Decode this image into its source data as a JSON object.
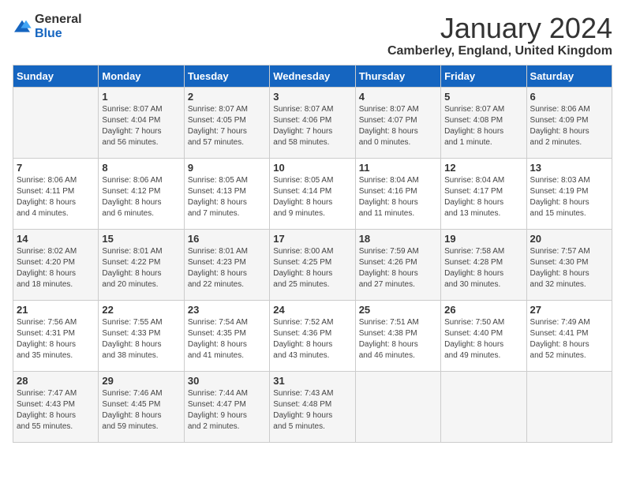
{
  "logo": {
    "general": "General",
    "blue": "Blue"
  },
  "title": "January 2024",
  "location": "Camberley, England, United Kingdom",
  "headers": [
    "Sunday",
    "Monday",
    "Tuesday",
    "Wednesday",
    "Thursday",
    "Friday",
    "Saturday"
  ],
  "weeks": [
    [
      {
        "day": "",
        "info": ""
      },
      {
        "day": "1",
        "info": "Sunrise: 8:07 AM\nSunset: 4:04 PM\nDaylight: 7 hours\nand 56 minutes."
      },
      {
        "day": "2",
        "info": "Sunrise: 8:07 AM\nSunset: 4:05 PM\nDaylight: 7 hours\nand 57 minutes."
      },
      {
        "day": "3",
        "info": "Sunrise: 8:07 AM\nSunset: 4:06 PM\nDaylight: 7 hours\nand 58 minutes."
      },
      {
        "day": "4",
        "info": "Sunrise: 8:07 AM\nSunset: 4:07 PM\nDaylight: 8 hours\nand 0 minutes."
      },
      {
        "day": "5",
        "info": "Sunrise: 8:07 AM\nSunset: 4:08 PM\nDaylight: 8 hours\nand 1 minute."
      },
      {
        "day": "6",
        "info": "Sunrise: 8:06 AM\nSunset: 4:09 PM\nDaylight: 8 hours\nand 2 minutes."
      }
    ],
    [
      {
        "day": "7",
        "info": "Sunrise: 8:06 AM\nSunset: 4:11 PM\nDaylight: 8 hours\nand 4 minutes."
      },
      {
        "day": "8",
        "info": "Sunrise: 8:06 AM\nSunset: 4:12 PM\nDaylight: 8 hours\nand 6 minutes."
      },
      {
        "day": "9",
        "info": "Sunrise: 8:05 AM\nSunset: 4:13 PM\nDaylight: 8 hours\nand 7 minutes."
      },
      {
        "day": "10",
        "info": "Sunrise: 8:05 AM\nSunset: 4:14 PM\nDaylight: 8 hours\nand 9 minutes."
      },
      {
        "day": "11",
        "info": "Sunrise: 8:04 AM\nSunset: 4:16 PM\nDaylight: 8 hours\nand 11 minutes."
      },
      {
        "day": "12",
        "info": "Sunrise: 8:04 AM\nSunset: 4:17 PM\nDaylight: 8 hours\nand 13 minutes."
      },
      {
        "day": "13",
        "info": "Sunrise: 8:03 AM\nSunset: 4:19 PM\nDaylight: 8 hours\nand 15 minutes."
      }
    ],
    [
      {
        "day": "14",
        "info": "Sunrise: 8:02 AM\nSunset: 4:20 PM\nDaylight: 8 hours\nand 18 minutes."
      },
      {
        "day": "15",
        "info": "Sunrise: 8:01 AM\nSunset: 4:22 PM\nDaylight: 8 hours\nand 20 minutes."
      },
      {
        "day": "16",
        "info": "Sunrise: 8:01 AM\nSunset: 4:23 PM\nDaylight: 8 hours\nand 22 minutes."
      },
      {
        "day": "17",
        "info": "Sunrise: 8:00 AM\nSunset: 4:25 PM\nDaylight: 8 hours\nand 25 minutes."
      },
      {
        "day": "18",
        "info": "Sunrise: 7:59 AM\nSunset: 4:26 PM\nDaylight: 8 hours\nand 27 minutes."
      },
      {
        "day": "19",
        "info": "Sunrise: 7:58 AM\nSunset: 4:28 PM\nDaylight: 8 hours\nand 30 minutes."
      },
      {
        "day": "20",
        "info": "Sunrise: 7:57 AM\nSunset: 4:30 PM\nDaylight: 8 hours\nand 32 minutes."
      }
    ],
    [
      {
        "day": "21",
        "info": "Sunrise: 7:56 AM\nSunset: 4:31 PM\nDaylight: 8 hours\nand 35 minutes."
      },
      {
        "day": "22",
        "info": "Sunrise: 7:55 AM\nSunset: 4:33 PM\nDaylight: 8 hours\nand 38 minutes."
      },
      {
        "day": "23",
        "info": "Sunrise: 7:54 AM\nSunset: 4:35 PM\nDaylight: 8 hours\nand 41 minutes."
      },
      {
        "day": "24",
        "info": "Sunrise: 7:52 AM\nSunset: 4:36 PM\nDaylight: 8 hours\nand 43 minutes."
      },
      {
        "day": "25",
        "info": "Sunrise: 7:51 AM\nSunset: 4:38 PM\nDaylight: 8 hours\nand 46 minutes."
      },
      {
        "day": "26",
        "info": "Sunrise: 7:50 AM\nSunset: 4:40 PM\nDaylight: 8 hours\nand 49 minutes."
      },
      {
        "day": "27",
        "info": "Sunrise: 7:49 AM\nSunset: 4:41 PM\nDaylight: 8 hours\nand 52 minutes."
      }
    ],
    [
      {
        "day": "28",
        "info": "Sunrise: 7:47 AM\nSunset: 4:43 PM\nDaylight: 8 hours\nand 55 minutes."
      },
      {
        "day": "29",
        "info": "Sunrise: 7:46 AM\nSunset: 4:45 PM\nDaylight: 8 hours\nand 59 minutes."
      },
      {
        "day": "30",
        "info": "Sunrise: 7:44 AM\nSunset: 4:47 PM\nDaylight: 9 hours\nand 2 minutes."
      },
      {
        "day": "31",
        "info": "Sunrise: 7:43 AM\nSunset: 4:48 PM\nDaylight: 9 hours\nand 5 minutes."
      },
      {
        "day": "",
        "info": ""
      },
      {
        "day": "",
        "info": ""
      },
      {
        "day": "",
        "info": ""
      }
    ]
  ]
}
